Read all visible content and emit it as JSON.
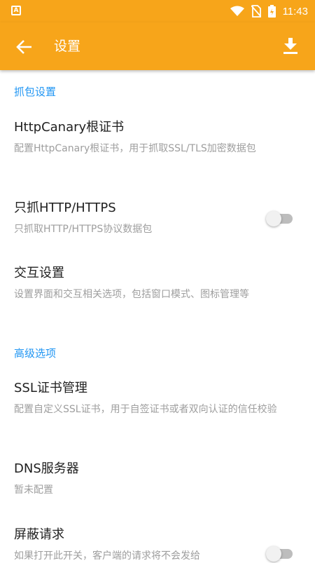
{
  "status_bar": {
    "sim_icon": "A",
    "icons": [
      "wifi-icon",
      "no-sim-icon",
      "battery-icon"
    ],
    "time": "11:43"
  },
  "app_bar": {
    "title": "设置",
    "back_icon": "arrow-left-icon",
    "action_icon": "download-icon"
  },
  "sections": [
    {
      "header": "抓包设置",
      "items": [
        {
          "title": "HttpCanary根证书",
          "desc": "配置HttpCanary根证书，用于抓取SSL/TLS加密数据包"
        },
        {
          "title": "只抓HTTP/HTTPS",
          "desc": "只抓取HTTP/HTTPS协议数据包",
          "toggle": false
        },
        {
          "title": "交互设置",
          "desc": "设置界面和交互相关选项，包括窗口模式、图标管理等"
        }
      ]
    },
    {
      "header": "高级选项",
      "items": [
        {
          "title": "SSL证书管理",
          "desc": "配置自定义SSL证书，用于自签证书或者双向认证的信任校验"
        },
        {
          "title": "DNS服务器",
          "desc": "暂未配置"
        },
        {
          "title": "屏蔽请求",
          "desc": "如果打开此开关，客户端的请求将不会发给",
          "toggle": false
        }
      ]
    }
  ],
  "colors": {
    "accent": "#F7A51A",
    "section_header": "#2196F3"
  }
}
